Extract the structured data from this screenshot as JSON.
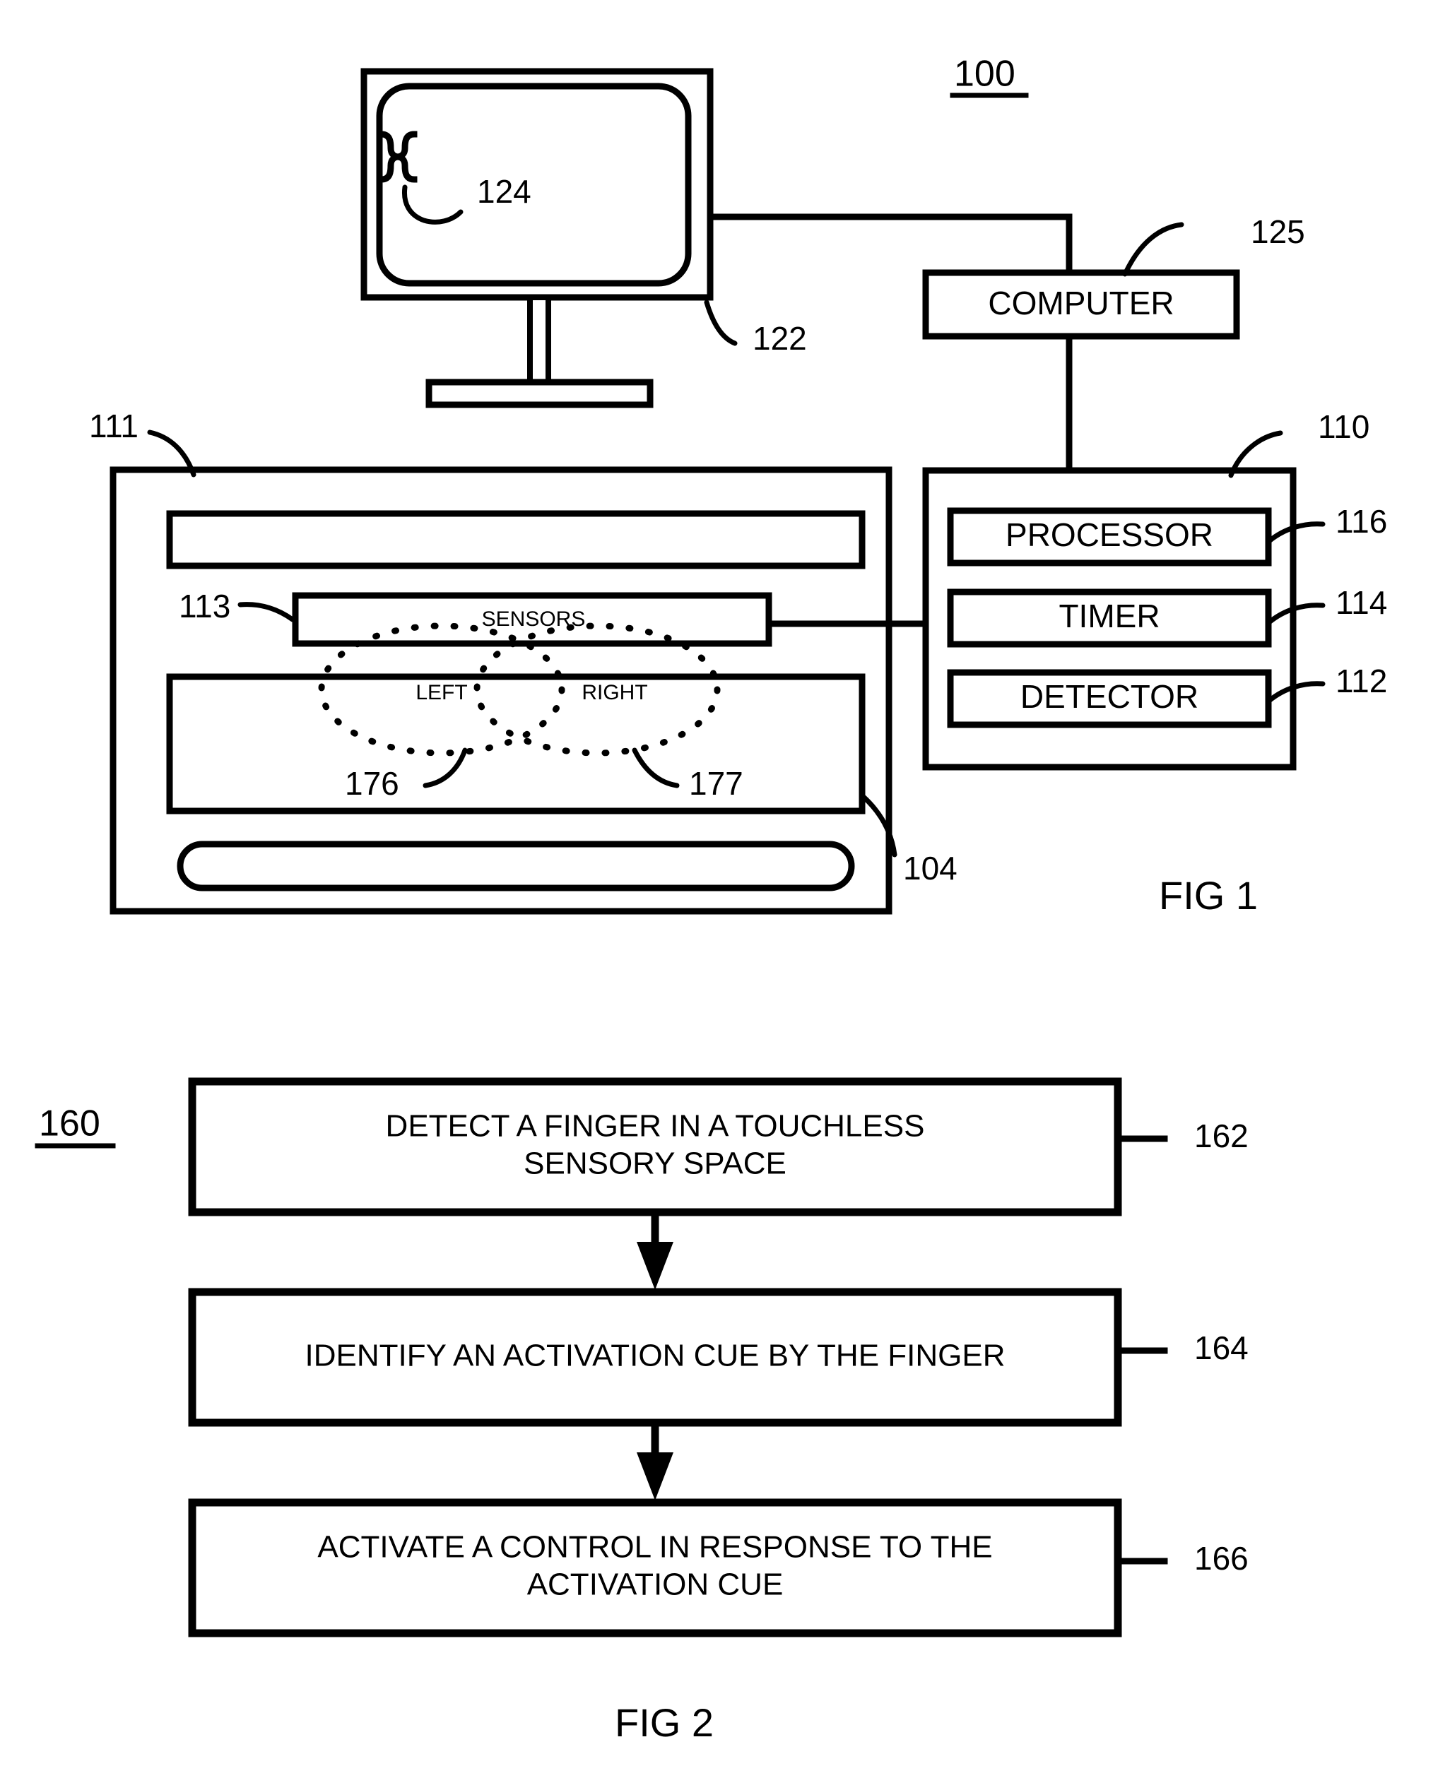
{
  "figure1": {
    "title_ref": "100",
    "fig_label": "FIG 1",
    "display": {
      "ref_screen": "122",
      "ref_cursor": "124",
      "cursor_icon": "hourglass-cursor-icon"
    },
    "computer_box": {
      "label": "COMPUTER",
      "ref": "125"
    },
    "controller_box": {
      "ref": "110",
      "items": [
        {
          "label": "PROCESSOR",
          "ref": "116"
        },
        {
          "label": "TIMER",
          "ref": "114"
        },
        {
          "label": "DETECTOR",
          "ref": "112"
        }
      ]
    },
    "device": {
      "ref_outer": "111",
      "ref_sensors": "113",
      "sensors_label": "SENSORS",
      "ref_keypad": "104",
      "zones": [
        {
          "label": "LEFT",
          "ref": "176"
        },
        {
          "label": "RIGHT",
          "ref": "177"
        }
      ]
    }
  },
  "figure2": {
    "title_ref": "160",
    "fig_label": "FIG 2",
    "steps": [
      {
        "ref": "162",
        "lines": [
          "DETECT A FINGER IN A TOUCHLESS",
          "SENSORY SPACE"
        ]
      },
      {
        "ref": "164",
        "lines": [
          "IDENTIFY AN ACTIVATION CUE BY THE FINGER"
        ]
      },
      {
        "ref": "166",
        "lines": [
          "ACTIVATE A CONTROL IN RESPONSE TO THE",
          "ACTIVATION CUE"
        ]
      }
    ]
  },
  "colors": {
    "ink": "#000000",
    "paper": "#ffffff"
  }
}
